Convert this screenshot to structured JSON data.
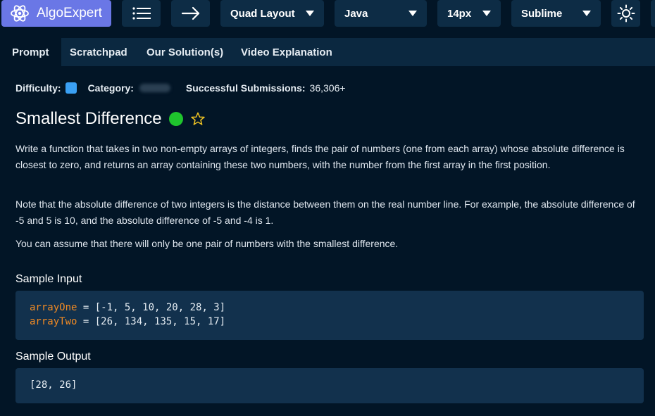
{
  "topbar": {
    "brand": "AlgoExpert",
    "layout_label": "Quad Layout",
    "language_label": "Java",
    "font_size_label": "14px",
    "theme_label": "Sublime"
  },
  "tabs": [
    {
      "label": "Prompt",
      "active": true
    },
    {
      "label": "Scratchpad",
      "active": false
    },
    {
      "label": "Our Solution(s)",
      "active": false
    },
    {
      "label": "Video Explanation",
      "active": false
    }
  ],
  "meta": {
    "difficulty_label": "Difficulty:",
    "category_label": "Category:",
    "submissions_label": "Successful Submissions:",
    "submissions_value": "36,306+"
  },
  "question": {
    "title": "Smallest Difference",
    "paragraphs": [
      "Write a function that takes in two non-empty arrays of integers, finds the pair of numbers (one from each array) whose absolute difference is closest to zero, and returns an array containing these two numbers, with the number from the first array in the first position.",
      "Note that the absolute difference of two integers is the distance between them on the real number line. For example, the absolute difference of -5 and 5 is 10, and the absolute difference of -5 and -4 is 1.",
      "You can assume that there will only be one pair of numbers with the smallest difference."
    ]
  },
  "sample_input": {
    "heading": "Sample Input",
    "lines": [
      {
        "var": "arrayOne",
        "rest": " = [-1, 5, 10, 20, 28, 3]"
      },
      {
        "var": "arrayTwo",
        "rest": " = [26, 134, 135, 15, 17]"
      }
    ]
  },
  "sample_output": {
    "heading": "Sample Output",
    "value": "[28, 26]"
  },
  "colors": {
    "brand": "#6a77e6",
    "background": "#021526",
    "code_background": "#12314d",
    "variable": "#f08a24",
    "status_green": "#1fc42d",
    "difficulty_blue": "#3aa0f4"
  }
}
